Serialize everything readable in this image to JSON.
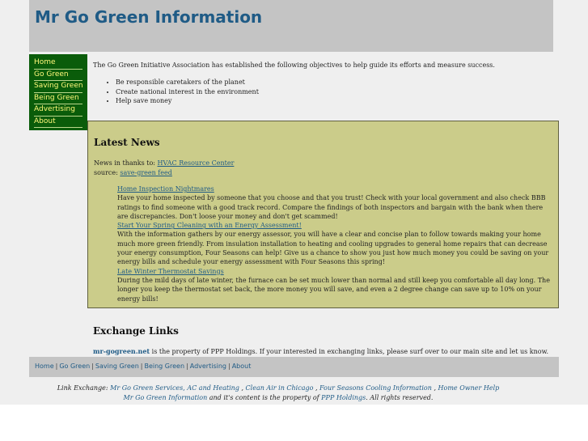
{
  "header": {
    "title": "Mr Go Green Information"
  },
  "sidebar": {
    "items": [
      {
        "label": "Home"
      },
      {
        "label": "Go Green"
      },
      {
        "label": "Saving Green"
      },
      {
        "label": "Being Green"
      },
      {
        "label": "Advertising"
      },
      {
        "label": "About"
      }
    ]
  },
  "intro": {
    "text": "The Go Green Initiative Association has established the following objectives to help guide its efforts and measure success.",
    "objectives": [
      "Be responsible caretakers of the planet",
      "Create national interest in the environment",
      "Help save money"
    ]
  },
  "news": {
    "title": "Latest News",
    "credit_prefix": "News in thanks to: ",
    "credit_link": "HVAC Resource Center",
    "source_prefix": "source: ",
    "source_link": "save-green feed",
    "articles": [
      {
        "title": "Home Inspection Nightmares",
        "body": "Have your home inspected by someone that you choose and that you trust! Check with your local government and also check BBB ratings to find someone with a good track record. Compare the findings of both inspectors and bargain with the bank when there are discrepancies. Don't loose your money and don't get scammed!"
      },
      {
        "title": "Start Your Spring Cleaning with an Energy Assessment!",
        "body": "With the information gathers by our energy assessor, you will have a clear and concise plan to follow towards making your home much more green friendly. From insulation installation to heating and cooling upgrades to general home repairs that can decrease your energy consumption, Four Seasons can help! Give us a chance to show you just how much money you could be saving on your energy bills and schedule your energy assessment with Four Seasons this spring!"
      },
      {
        "title": "Late Winter Thermostat Savings",
        "body": "During the mild days of late winter, the furnace can be set much lower than normal and still keep you comfortable all day long. The longer you keep the thermostat set back, the more money you will save, and even a 2 degree change can save up to 10% on your energy bills!"
      }
    ]
  },
  "exchange": {
    "title": "Exchange Links",
    "site": "mr-gogreen.net",
    "text": " is the property of PPP Holdings. If your interested in exchanging links, please surf over to our main site and let us know."
  },
  "footer_nav": {
    "items": [
      "Home",
      "Go Green",
      "Saving Green",
      "Being Green",
      "Advertising",
      "About"
    ],
    "separator": "|"
  },
  "link_exchange": {
    "prefix": "Link Exchange: ",
    "links": [
      "Mr Go Green Services, AC and Heating",
      "Clean Air in Chicago",
      "Four Seasons Cooling Information",
      "Home Owner Help"
    ],
    "separator": " , ",
    "site_link": "Mr Go Green Information",
    "middle": " and it's content is the property of ",
    "owner_link": "PPP Holdings",
    "suffix": ". All rights reserved."
  }
}
